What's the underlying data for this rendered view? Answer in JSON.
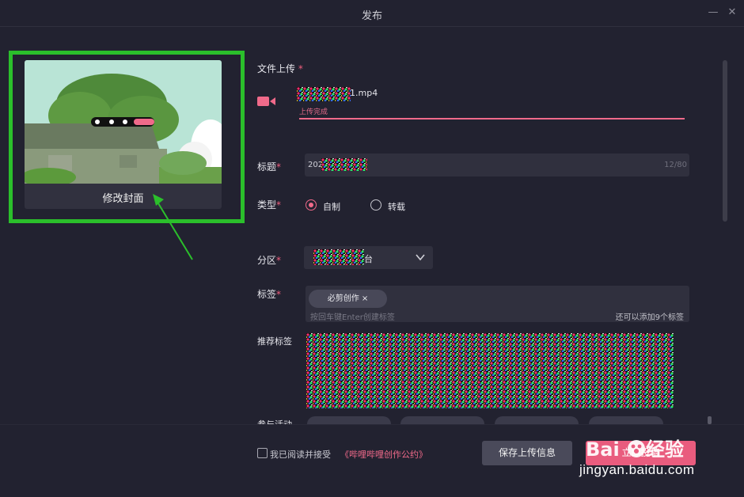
{
  "window": {
    "title": "发布",
    "minimize_glyph": "—",
    "close_glyph": "✕"
  },
  "cover": {
    "label": "修改封面"
  },
  "upload": {
    "label": "文件上传",
    "required": "*",
    "file_name_suffix": "1.mp4",
    "status": "上传完成",
    "progress": 1.0,
    "icon": "video-camera-icon"
  },
  "title_field": {
    "label": "标题",
    "required": "*",
    "prefix": "202",
    "count": "12/80"
  },
  "type_field": {
    "label": "类型",
    "required": "*",
    "options": [
      {
        "label": "自制",
        "selected": true
      },
      {
        "label": "转载",
        "selected": false
      }
    ]
  },
  "category_field": {
    "label": "分区",
    "required": "*",
    "value_suffix": "台"
  },
  "tags_field": {
    "label": "标签",
    "required": "*",
    "chips": [
      "必剪创作 ×"
    ],
    "hint": "按回车键Enter创建标签",
    "remaining": "还可以添加9个标签"
  },
  "recommended_tags": {
    "label": "推荐标签"
  },
  "activities": {
    "label": "参与活动"
  },
  "footer": {
    "agree_text": "我已阅读并接受",
    "agree_link": "《哔哩哔哩创作公约》",
    "save_label": "保存上传信息",
    "submit_label": "立即投稿"
  },
  "watermark": {
    "brand": "Baidu经验",
    "url": "jingyan.baidu.com"
  },
  "colors": {
    "accent": "#f06a8a",
    "annotation": "#2bbf2b",
    "background": "#222230"
  }
}
